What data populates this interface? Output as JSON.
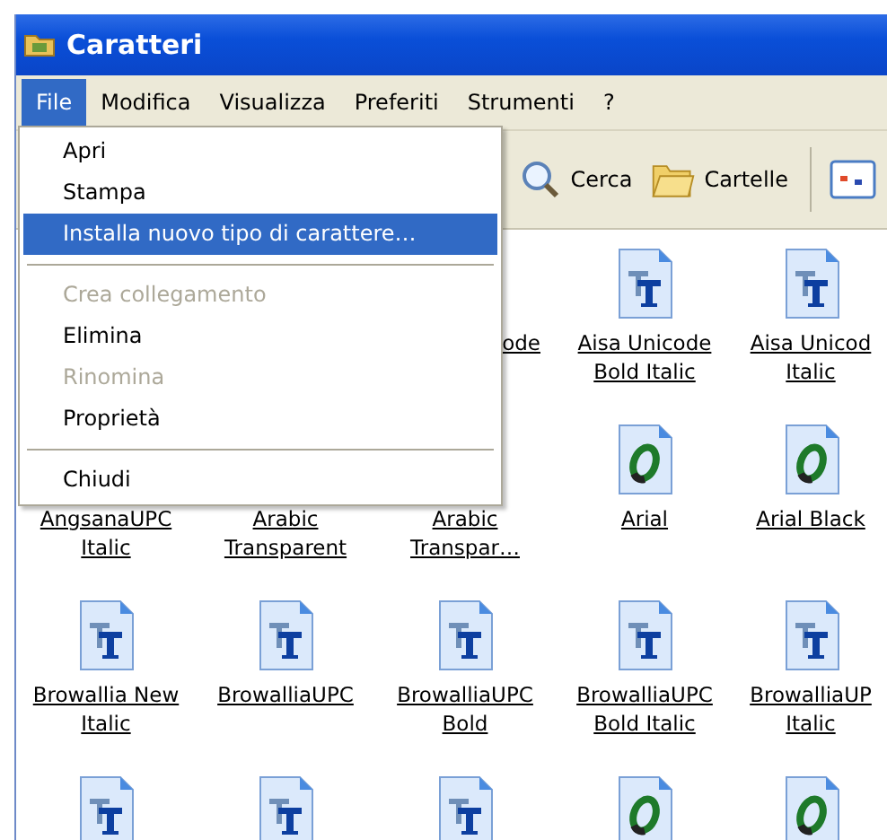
{
  "window": {
    "title": "Caratteri"
  },
  "menu_bar": [
    {
      "label": "File",
      "selected": true
    },
    {
      "label": "Modifica",
      "selected": false
    },
    {
      "label": "Visualizza",
      "selected": false
    },
    {
      "label": "Preferiti",
      "selected": false
    },
    {
      "label": "Strumenti",
      "selected": false
    },
    {
      "label": "?",
      "selected": false
    }
  ],
  "toolbar": [
    {
      "kind": "search",
      "label": "Cerca"
    },
    {
      "kind": "folders",
      "label": "Cartelle"
    },
    {
      "kind": "views"
    }
  ],
  "file_menu": [
    {
      "kind": "item",
      "label": "Apri",
      "selected": false,
      "disabled": false
    },
    {
      "kind": "item",
      "label": "Stampa",
      "selected": false,
      "disabled": false
    },
    {
      "kind": "item",
      "label": "Installa nuovo tipo di carattere…",
      "selected": true,
      "disabled": false
    },
    {
      "kind": "separator"
    },
    {
      "kind": "item",
      "label": "Crea collegamento",
      "selected": false,
      "disabled": true
    },
    {
      "kind": "item",
      "label": "Elimina",
      "selected": false,
      "disabled": false
    },
    {
      "kind": "item",
      "label": "Rinomina",
      "selected": false,
      "disabled": true
    },
    {
      "kind": "item",
      "label": "Proprietà",
      "selected": false,
      "disabled": false
    },
    {
      "kind": "separator"
    },
    {
      "kind": "item",
      "label": "Chiudi",
      "selected": false,
      "disabled": false
    }
  ],
  "fonts": [
    {
      "kind": "covered"
    },
    {
      "kind": "covered"
    },
    {
      "kind": "covered",
      "label": "ode"
    },
    {
      "kind": "truetype",
      "label": "Aisa Unicode Bold Italic"
    },
    {
      "kind": "truetype",
      "label": "Aisa Unicod Italic"
    },
    {
      "kind": "covered",
      "label": "AngsanaUPC Italic"
    },
    {
      "kind": "covered",
      "label": "Arabic Transparent"
    },
    {
      "kind": "covered",
      "label": "Arabic Transpar…"
    },
    {
      "kind": "opentype",
      "label": "Arial"
    },
    {
      "kind": "opentype",
      "label": "Arial Black"
    },
    {
      "kind": "truetype",
      "label": "Browallia New Italic"
    },
    {
      "kind": "truetype",
      "label": "BrowalliaUPC"
    },
    {
      "kind": "truetype",
      "label": "BrowalliaUPC Bold"
    },
    {
      "kind": "truetype",
      "label": "BrowalliaUPC Bold Italic"
    },
    {
      "kind": "truetype",
      "label": "BrowalliaUP Italic"
    },
    {
      "kind": "truetype"
    },
    {
      "kind": "truetype"
    },
    {
      "kind": "truetype"
    },
    {
      "kind": "opentype"
    },
    {
      "kind": "opentype"
    }
  ]
}
